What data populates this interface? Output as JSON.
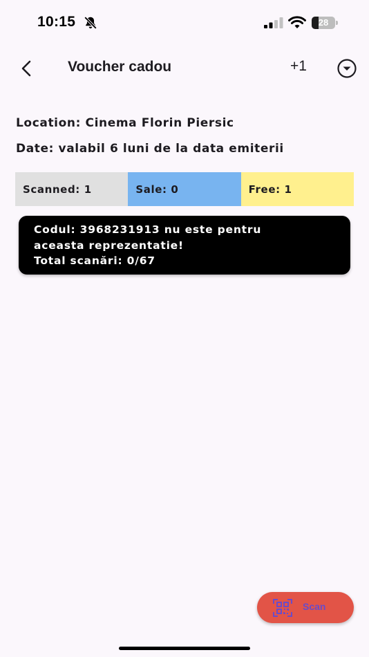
{
  "status_bar": {
    "time": "10:15",
    "battery_level": "28",
    "battery_fraction": 0.28,
    "icons": [
      "bell-slash-icon",
      "cellular-signal-icon",
      "wifi-icon",
      "battery-icon"
    ]
  },
  "app_bar": {
    "title": "Voucher cadou",
    "plus_label": "+1",
    "back_icon": "chevron-left-icon",
    "dropdown_icon": "circle-chevron-down-icon"
  },
  "info": {
    "location": "Location: Cinema Florin Piersic",
    "date": "Date: valabil 6 luni de la data emiterii"
  },
  "stats": {
    "scanned": "Scanned: 1",
    "sale": "Sale: 0",
    "free": "Free: 1",
    "colors": {
      "scanned": "#e0e0e0",
      "sale": "#78b4f0",
      "free": "#fff08e"
    }
  },
  "message": {
    "line1": "Codul: 3968231913 nu este pentru",
    "line2": "aceasta reprezentatie!",
    "line3": "Total scanări: 0/67"
  },
  "scan": {
    "label": "Scan",
    "icon": "qr-scan-icon",
    "color": "#e25447"
  }
}
